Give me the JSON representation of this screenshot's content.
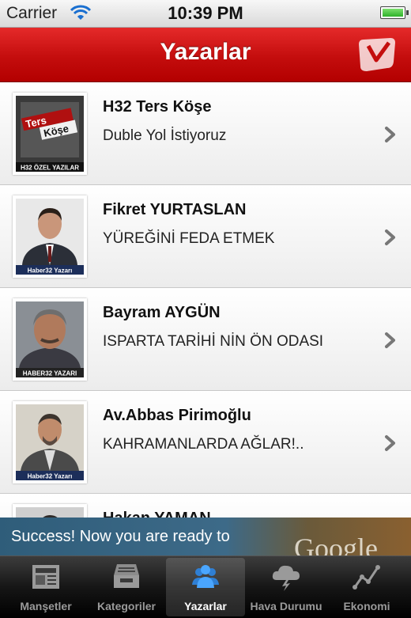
{
  "status_bar": {
    "carrier": "Carrier",
    "time": "10:39 PM"
  },
  "nav": {
    "title": "Yazarlar"
  },
  "authors": [
    {
      "name": "H32 Ters Köşe",
      "article": "Duble Yol İstiyoruz",
      "thumb_caption": "H32 ÖZEL YAZILAR",
      "thumb_text_1": "Ters",
      "thumb_text_2": "Köşe"
    },
    {
      "name": "Fikret YURTASLAN",
      "article": "YÜREĞİNİ FEDA ETMEK",
      "thumb_caption": "Haber32 Yazarı"
    },
    {
      "name": "Bayram AYGÜN",
      "article": "ISPARTA TARİHİ NİN ÖN ODASI",
      "thumb_caption": "HABER32 YAZARI"
    },
    {
      "name": "Av.Abbas Pirimoğlu",
      "article": "KAHRAMANLARDA AĞLAR!..",
      "thumb_caption": "Haber32 Yazarı"
    },
    {
      "name": "Hakan YAMAN",
      "article": ""
    }
  ],
  "ad": {
    "text": "Success! Now you are ready to",
    "brand": "Google"
  },
  "tabs": [
    {
      "label": "Manşetler",
      "icon": "newspaper-icon"
    },
    {
      "label": "Kategoriler",
      "icon": "inbox-tray-icon"
    },
    {
      "label": "Yazarlar",
      "icon": "people-icon",
      "active": true
    },
    {
      "label": "Hava Durumu",
      "icon": "weather-cloud-icon"
    },
    {
      "label": "Ekonomi",
      "icon": "line-chart-icon"
    }
  ],
  "colors": {
    "nav_red": "#c40d0d",
    "tab_active_blue": "#3a8fe0"
  }
}
